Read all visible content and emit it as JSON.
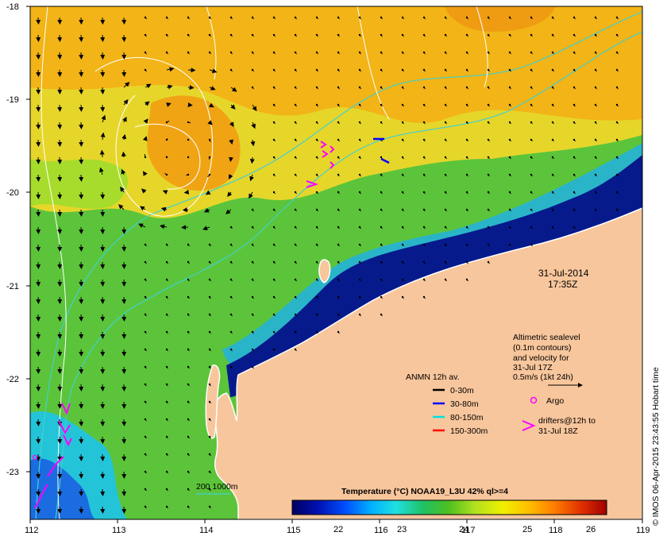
{
  "map": {
    "lon_ticks": [
      "112",
      "113",
      "114",
      "115",
      "116",
      "117",
      "118",
      "119"
    ],
    "lat_ticks": [
      "-18",
      "-19",
      "-20",
      "-21",
      "-22",
      "-23"
    ],
    "lon_range": [
      112,
      119
    ],
    "lat_range": [
      -23.5,
      -18
    ],
    "colors": {
      "land": "#f8c69c",
      "deep_blue": "#061a8c",
      "shelf_blue": "#1e5fd8",
      "cyan_water": "#24c4d8",
      "green_water": "#52c23a",
      "yellow_water": "#e8da24",
      "orange_water": "#f0a010"
    }
  },
  "timestamp": {
    "date": "31-Jul-2014",
    "time": "17:35Z"
  },
  "info": {
    "altimetry_lines": [
      "Altimetric sealevel",
      "(0.1m contours)",
      "and velocity for",
      "31-Jul 17Z",
      "0.5m/s (1kt 24h)"
    ],
    "argo_label": "Argo",
    "drifters_lines": [
      "drifters@12h to",
      "31-Jul 18Z"
    ]
  },
  "legend": {
    "title": "ANMN 12h av.",
    "items": [
      {
        "label": "0-30m",
        "color": "#000000"
      },
      {
        "label": "30-80m",
        "color": "#0000ff"
      },
      {
        "label": "80-150m",
        "color": "#00e0e0"
      },
      {
        "label": "150-300m",
        "color": "#ff0000"
      }
    ]
  },
  "bathymetry_key": {
    "label": "200 1000m",
    "color": "#40d0d0"
  },
  "colorbar": {
    "title": "Temperature (°C) NOAA19_L3U 42% ql>=4",
    "ticks": [
      "22",
      "23",
      "24",
      "25",
      "26"
    ],
    "range": [
      21.4,
      26.2
    ],
    "stops": [
      "#000060",
      "#0010b0",
      "#0050ff",
      "#00b0ff",
      "#20e0e0",
      "#20c060",
      "#50c020",
      "#b0e020",
      "#f0f000",
      "#ffc000",
      "#ff8000",
      "#e03000",
      "#a00000"
    ]
  },
  "credit": "© IMOS 06-Apr-2015 23:43:55 Hobart time"
}
